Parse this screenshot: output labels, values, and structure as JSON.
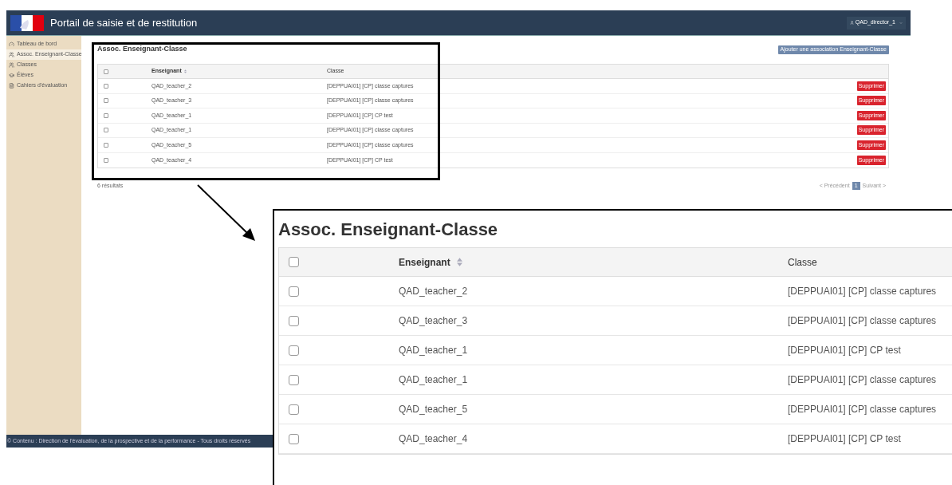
{
  "header": {
    "title": "Portail de saisie et de restitution",
    "user": "QAD_director_1"
  },
  "sidebar": {
    "items": [
      {
        "label": "Tableau de bord",
        "kind": "gauge",
        "selected": false
      },
      {
        "label": "Assoc. Enseignant-Classe",
        "kind": "users",
        "selected": true
      },
      {
        "label": "Classes",
        "kind": "users",
        "selected": false
      },
      {
        "label": "Élèves",
        "kind": "cap",
        "selected": false
      },
      {
        "label": "Cahiers d'évaluation",
        "kind": "file",
        "selected": false
      }
    ]
  },
  "page": {
    "title": "Assoc. Enseignant-Classe",
    "add_button": "Ajouter une association Enseignant-Classe",
    "table": {
      "columns": [
        "Enseignant",
        "Classe"
      ],
      "header_checked": false,
      "rows": [
        {
          "checked": false,
          "teacher": "QAD_teacher_2",
          "class": "[DEPPUAI01] [CP] classe captures",
          "action": "Supprimer"
        },
        {
          "checked": false,
          "teacher": "QAD_teacher_3",
          "class": "[DEPPUAI01] [CP] classe captures",
          "action": "Supprimer"
        },
        {
          "checked": false,
          "teacher": "QAD_teacher_1",
          "class": "[DEPPUAI01] [CP] CP test",
          "action": "Supprimer"
        },
        {
          "checked": false,
          "teacher": "QAD_teacher_1",
          "class": "[DEPPUAI01] [CP] classe captures",
          "action": "Supprimer"
        },
        {
          "checked": false,
          "teacher": "QAD_teacher_5",
          "class": "[DEPPUAI01] [CP] classe captures",
          "action": "Supprimer"
        },
        {
          "checked": false,
          "teacher": "QAD_teacher_4",
          "class": "[DEPPUAI01] [CP] CP test",
          "action": "Supprimer"
        }
      ]
    },
    "result_count": "6 résultats",
    "pagination": {
      "previous": "< Précédent",
      "pages": [
        {
          "label": "1",
          "selected": true
        }
      ],
      "next": "Suivant >"
    }
  },
  "footer": "© Contenu : Direction de l'évaluation, de la prospective et de la performance - Tous droits réservés",
  "zoom_inset": {
    "title": "Assoc. Enseignant-Classe",
    "columns": [
      "Enseignant",
      "Classe"
    ],
    "header_checked": false,
    "rows": [
      {
        "checked": false,
        "teacher": "QAD_teacher_2",
        "class": "[DEPPUAI01] [CP] classe captures"
      },
      {
        "checked": false,
        "teacher": "QAD_teacher_3",
        "class": "[DEPPUAI01] [CP] classe captures"
      },
      {
        "checked": false,
        "teacher": "QAD_teacher_1",
        "class": "[DEPPUAI01] [CP] CP test"
      },
      {
        "checked": false,
        "teacher": "QAD_teacher_1",
        "class": "[DEPPUAI01] [CP] classe captures"
      },
      {
        "checked": false,
        "teacher": "QAD_teacher_5",
        "class": "[DEPPUAI01] [CP] classe captures"
      },
      {
        "checked": false,
        "teacher": "QAD_teacher_4",
        "class": "[DEPPUAI01] [CP] CP test"
      }
    ]
  }
}
